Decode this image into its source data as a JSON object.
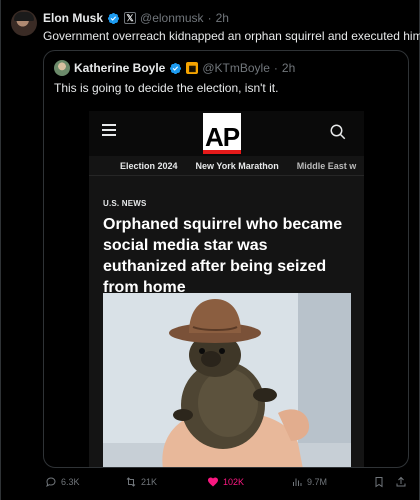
{
  "post": {
    "author_name": "Elon Musk",
    "author_handle": "@elonmusk",
    "time": "2h",
    "text": "Government overreach kidnapped an orphan squirrel and executed him ..."
  },
  "quote": {
    "author_name": "Katherine Boyle",
    "author_handle": "@KTmBoyle",
    "time": "2h",
    "text": "This is going to decide the election, isn't it."
  },
  "article": {
    "logo": "AP",
    "nav": [
      "Election 2024",
      "New York Marathon",
      "Middle East w"
    ],
    "category": "U.S. NEWS",
    "headline": "Orphaned squirrel who became social media star was euthanized after being seized from home"
  },
  "actions": {
    "replies": "6.3K",
    "reposts": "21K",
    "likes": "102K",
    "views": "9.7M"
  },
  "colors": {
    "background": "#000000",
    "text": "#e7e9ea",
    "muted": "#71767b",
    "verified_blue": "#1d9bf0",
    "like_pink": "#f91880",
    "ap_red": "#e41a1a"
  },
  "icons": [
    "verified-icon",
    "x-affiliate-icon",
    "org-badge-icon",
    "menu-icon",
    "search-icon",
    "reply-icon",
    "repost-icon",
    "like-icon",
    "views-icon",
    "bookmark-icon",
    "share-icon"
  ]
}
